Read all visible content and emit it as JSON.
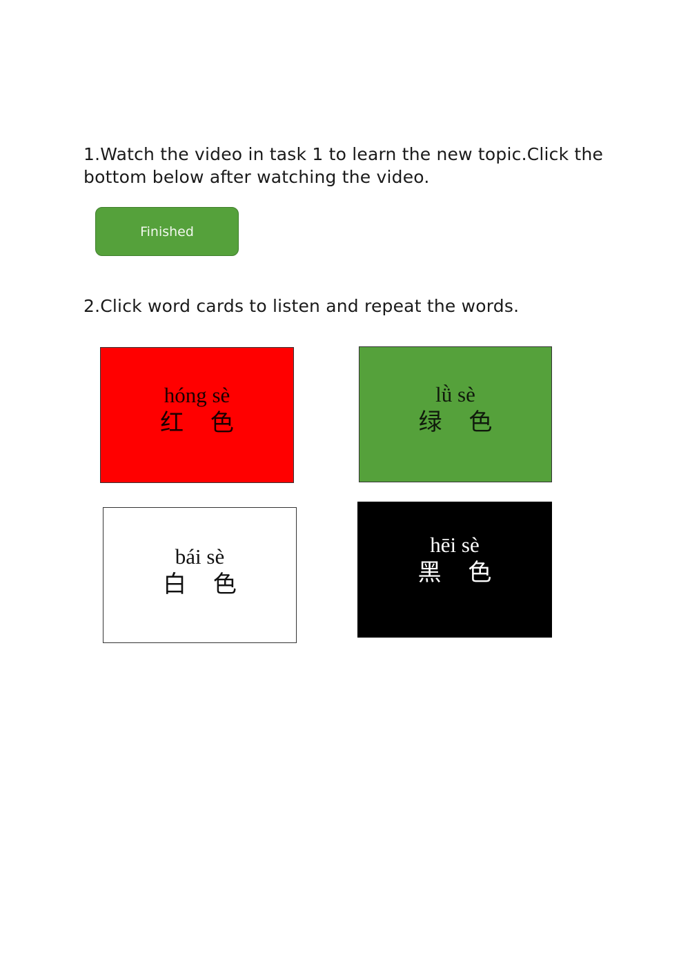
{
  "task1": {
    "instruction": "1.Watch the video in task 1 to learn the new topic.Click the bottom below after watching the video.",
    "button_label": "Finished",
    "button_color": "#55a13b"
  },
  "task2": {
    "instruction": "2.Click word cards to listen and repeat the words.",
    "cards": [
      {
        "pinyin": "hóng sè",
        "hanzi": "红 色",
        "color": "#ff0000"
      },
      {
        "pinyin": "lǜ sè",
        "hanzi": "绿 色",
        "color": "#55a13b"
      },
      {
        "pinyin": "bái sè",
        "hanzi": "白 色",
        "color": "#ffffff"
      },
      {
        "pinyin": "hēi sè",
        "hanzi": "黑 色",
        "color": "#000000"
      }
    ]
  }
}
